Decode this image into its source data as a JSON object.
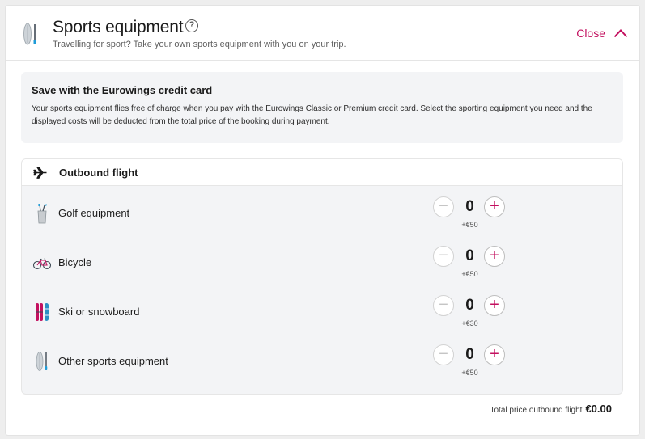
{
  "header": {
    "title": "Sports equipment",
    "subtitle": "Travelling for sport? Take your own sports equipment with you on your trip.",
    "help_icon": "question-circle-icon",
    "close_label": "Close",
    "close_icon": "chevron-up-icon",
    "icon": "paddleboard-icon"
  },
  "promo": {
    "title": "Save with the Eurowings credit card",
    "text": "Your sports equipment flies free of charge when you pay with the Eurowings Classic or Premium credit card. Select the sporting equipment you need and the displayed costs will be deducted from the total price of the booking during payment."
  },
  "flight": {
    "icon": "airplane-icon",
    "title": "Outbound flight",
    "items": [
      {
        "icon": "golf-bag-icon",
        "label": "Golf equipment",
        "count": "0",
        "price": "+€50"
      },
      {
        "icon": "bicycle-icon",
        "label": "Bicycle",
        "count": "0",
        "price": "+€50"
      },
      {
        "icon": "ski-snowboard-icon",
        "label": "Ski or snowboard",
        "count": "0",
        "price": "+€30"
      },
      {
        "icon": "paddleboard-icon",
        "label": "Other sports equipment",
        "count": "0",
        "price": "+€50"
      }
    ]
  },
  "total": {
    "label": "Total price outbound flight",
    "value": "€0.00"
  },
  "colors": {
    "accent": "#c3105f",
    "panel_bg": "#f3f4f6"
  }
}
